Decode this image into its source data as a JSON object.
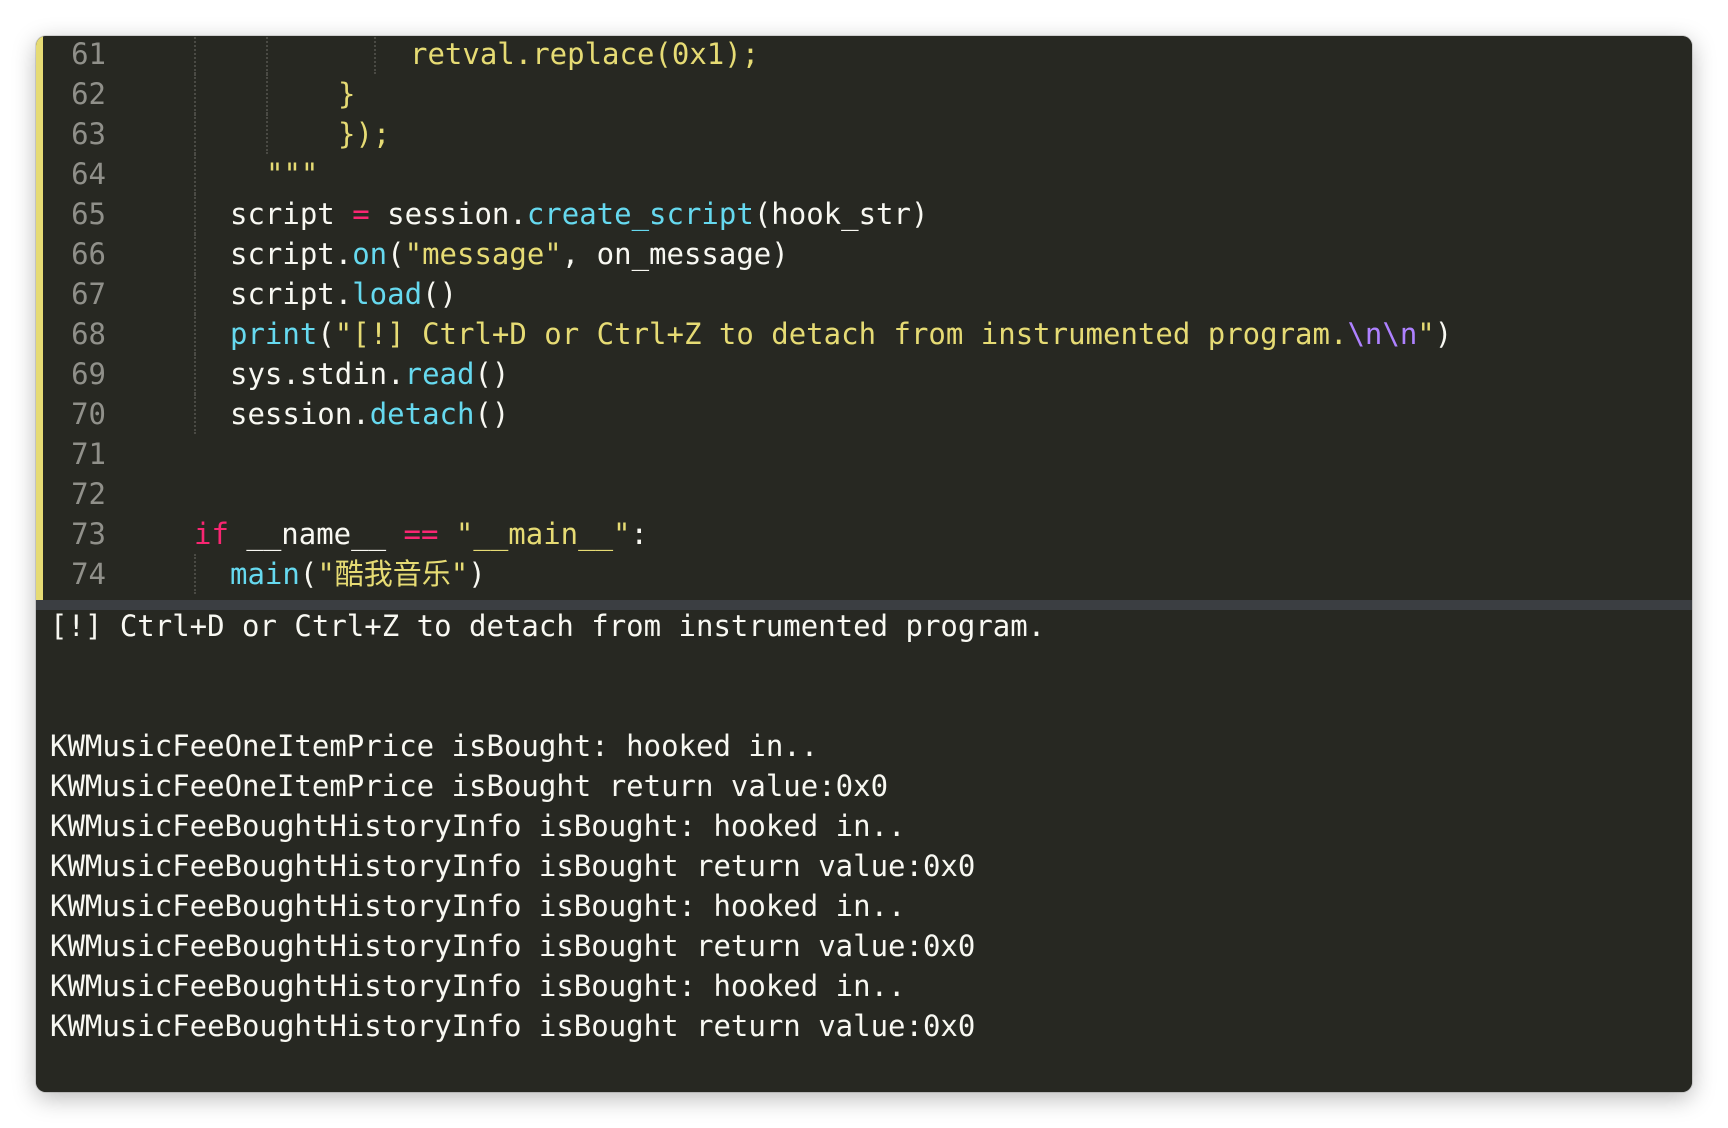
{
  "editor": {
    "lines": [
      {
        "num": "61",
        "tokens": [
          {
            "t": "retval.replace(0x1);",
            "c": "str"
          }
        ]
      },
      {
        "num": "62",
        "tokens": [
          {
            "t": "}",
            "c": "str"
          }
        ]
      },
      {
        "num": "63",
        "tokens": [
          {
            "t": "});",
            "c": "str"
          }
        ]
      },
      {
        "num": "64",
        "tokens": [
          {
            "t": "\"\"\"",
            "c": "str"
          }
        ]
      },
      {
        "num": "65",
        "tokens": [
          {
            "t": "script ",
            "c": "plain"
          },
          {
            "t": "=",
            "c": "op"
          },
          {
            "t": " session.",
            "c": "plain"
          },
          {
            "t": "create_script",
            "c": "fn"
          },
          {
            "t": "(hook_str)",
            "c": "plain"
          }
        ]
      },
      {
        "num": "66",
        "tokens": [
          {
            "t": "script.",
            "c": "plain"
          },
          {
            "t": "on",
            "c": "fn"
          },
          {
            "t": "(",
            "c": "plain"
          },
          {
            "t": "\"message\"",
            "c": "str"
          },
          {
            "t": ", on_message)",
            "c": "plain"
          }
        ]
      },
      {
        "num": "67",
        "tokens": [
          {
            "t": "script.",
            "c": "plain"
          },
          {
            "t": "load",
            "c": "fn"
          },
          {
            "t": "()",
            "c": "plain"
          }
        ]
      },
      {
        "num": "68",
        "tokens": [
          {
            "t": "print",
            "c": "fn"
          },
          {
            "t": "(",
            "c": "plain"
          },
          {
            "t": "\"[!] Ctrl+D or Ctrl+Z to detach from instrumented program.",
            "c": "str"
          },
          {
            "t": "\\n\\n",
            "c": "esc"
          },
          {
            "t": "\"",
            "c": "str"
          },
          {
            "t": ")",
            "c": "plain"
          }
        ]
      },
      {
        "num": "69",
        "tokens": [
          {
            "t": "sys.stdin.",
            "c": "plain"
          },
          {
            "t": "read",
            "c": "fn"
          },
          {
            "t": "()",
            "c": "plain"
          }
        ]
      },
      {
        "num": "70",
        "tokens": [
          {
            "t": "session.",
            "c": "plain"
          },
          {
            "t": "detach",
            "c": "fn"
          },
          {
            "t": "()",
            "c": "plain"
          }
        ]
      },
      {
        "num": "71",
        "tokens": []
      },
      {
        "num": "72",
        "tokens": []
      },
      {
        "num": "73",
        "tokens": [
          {
            "t": "if",
            "c": "kw"
          },
          {
            "t": " __name__ ",
            "c": "plain"
          },
          {
            "t": "==",
            "c": "op"
          },
          {
            "t": " ",
            "c": "plain"
          },
          {
            "t": "\"__main__\"",
            "c": "str"
          },
          {
            "t": ":",
            "c": "plain"
          }
        ]
      },
      {
        "num": "74",
        "tokens": [
          {
            "t": "main",
            "c": "fn"
          },
          {
            "t": "(",
            "c": "plain"
          },
          {
            "t": "\"酷我音乐\"",
            "c": "str"
          },
          {
            "t": ")",
            "c": "plain"
          }
        ]
      }
    ]
  },
  "terminal": {
    "lines": [
      "[!] Ctrl+D or Ctrl+Z to detach from instrumented program.",
      "",
      "",
      "KWMusicFeeOneItemPrice isBought: hooked in..",
      "KWMusicFeeOneItemPrice isBought return value:0x0",
      "KWMusicFeeBoughtHistoryInfo isBought: hooked in..",
      "KWMusicFeeBoughtHistoryInfo isBought return value:0x0",
      "KWMusicFeeBoughtHistoryInfo isBought: hooked in..",
      "KWMusicFeeBoughtHistoryInfo isBought return value:0x0",
      "KWMusicFeeBoughtHistoryInfo isBought: hooked in..",
      "KWMusicFeeBoughtHistoryInfo isBought return value:0x0"
    ]
  },
  "colors": {
    "background": "#272822",
    "foreground": "#f8f8f2",
    "string": "#e6db74",
    "function": "#66d9ef",
    "keyword": "#f92672",
    "escape": "#ae81ff",
    "line_number": "#90908a"
  }
}
